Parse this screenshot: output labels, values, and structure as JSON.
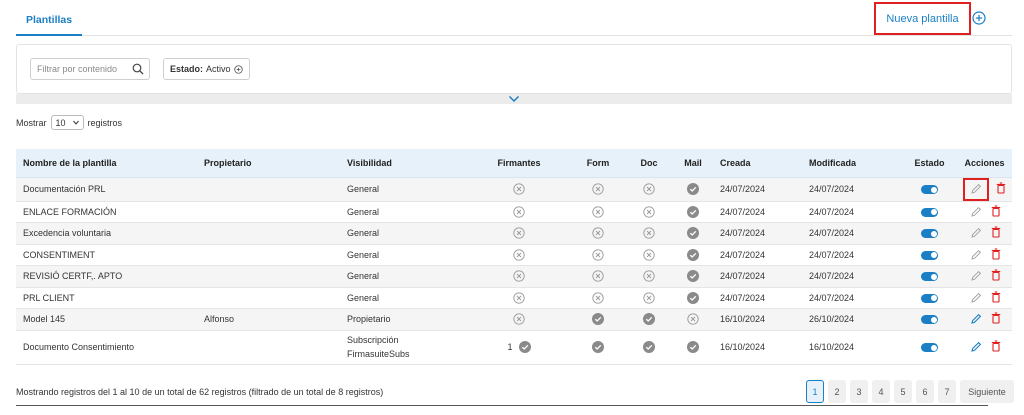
{
  "header": {
    "tab_label": "Plantillas",
    "new_button_label": "Nueva plantilla"
  },
  "filters": {
    "search_placeholder": "Filtrar por contenido",
    "state_label": "Estado:",
    "state_value": "Activo"
  },
  "show": {
    "prefix": "Mostrar",
    "value": "10",
    "suffix": "registros"
  },
  "table": {
    "columns": [
      "Nombre de la plantilla",
      "Propietario",
      "Visibilidad",
      "Firmantes",
      "Form",
      "Doc",
      "Mail",
      "Creada",
      "Modificada",
      "Estado",
      "Acciones"
    ],
    "rows": [
      {
        "name": "Documentación PRL",
        "owner": "",
        "visibility": "General",
        "visibility2": "",
        "signers_count": "",
        "created": "24/07/2024",
        "modified": "24/07/2024"
      },
      {
        "name": "ENLACE FORMACIÓN",
        "owner": "",
        "visibility": "General",
        "visibility2": "",
        "signers_count": "",
        "created": "24/07/2024",
        "modified": "24/07/2024"
      },
      {
        "name": "Excedencia voluntaria",
        "owner": "",
        "visibility": "General",
        "visibility2": "",
        "signers_count": "",
        "created": "24/07/2024",
        "modified": "24/07/2024"
      },
      {
        "name": "CONSENTIMENT",
        "owner": "",
        "visibility": "General",
        "visibility2": "",
        "signers_count": "",
        "created": "24/07/2024",
        "modified": "24/07/2024"
      },
      {
        "name": "REVISIÓ CERTF,. APTO",
        "owner": "",
        "visibility": "General",
        "visibility2": "",
        "signers_count": "",
        "created": "24/07/2024",
        "modified": "24/07/2024"
      },
      {
        "name": "PRL CLIENT",
        "owner": "",
        "visibility": "General",
        "visibility2": "",
        "signers_count": "",
        "created": "24/07/2024",
        "modified": "24/07/2024"
      },
      {
        "name": "Model 145",
        "owner": "Alfonso",
        "visibility": "Propietario",
        "visibility2": "",
        "signers_count": "",
        "created": "16/10/2024",
        "modified": "26/10/2024"
      },
      {
        "name": "Documento Consentimiento",
        "owner": "",
        "visibility": "Subscripción",
        "visibility2": "FirmasuiteSubs",
        "signers_count": "1",
        "created": "16/10/2024",
        "modified": "16/10/2024"
      }
    ]
  },
  "footer": {
    "summary": "Mostrando registros del 1 al 10 de un total de 62 registros (filtrado de un total de 8 registros)",
    "pages": [
      "1",
      "2",
      "3",
      "4",
      "5",
      "6",
      "7"
    ],
    "next_label": "Siguiente"
  },
  "colors": {
    "accent": "#1a7fc4",
    "highlight": "#e02020",
    "delete": "#e02020",
    "check": "#8a8a8a"
  }
}
